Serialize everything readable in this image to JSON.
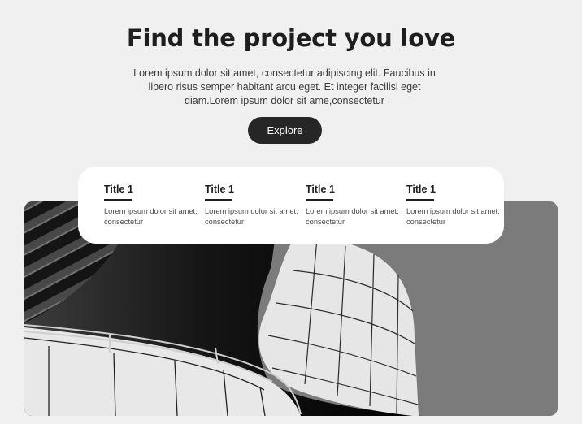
{
  "hero": {
    "title": "Find the project you love",
    "description": "Lorem ipsum dolor sit amet, consectetur adipiscing elit. Faucibus in libero risus semper habitant arcu eget. Et integer facilisi eget diam.Lorem ipsum dolor sit ame,consectetur",
    "cta_label": "Explore"
  },
  "cards": [
    {
      "title": "Title 1",
      "text": "Lorem ipsum dolor sit amet, consectetur"
    },
    {
      "title": "Title 1",
      "text": "Lorem ipsum dolor sit amet, consectetur"
    },
    {
      "title": "Title 1",
      "text": "Lorem ipsum dolor sit amet, consectetur"
    },
    {
      "title": "Title 1",
      "text": "Lorem ipsum dolor sit amet, consectetur"
    }
  ],
  "colors": {
    "background": "#f0f0f0",
    "button": "#262626",
    "card_bg": "#ffffff",
    "photo_sky": "#7b7b7b"
  }
}
